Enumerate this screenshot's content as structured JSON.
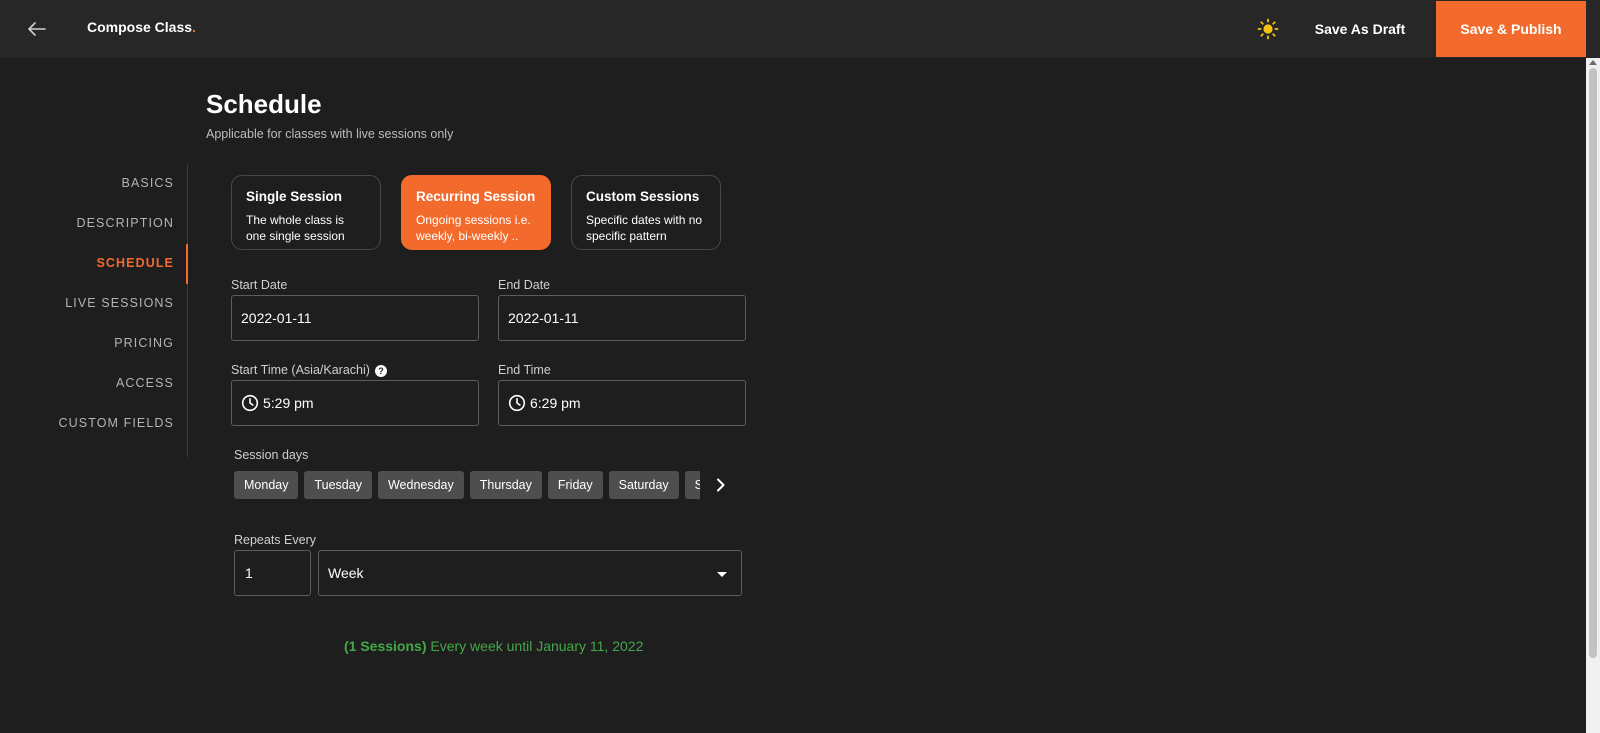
{
  "header": {
    "title": "Compose Class",
    "title_dot": ".",
    "save_draft_label": "Save As Draft",
    "save_publish_label": "Save & Publish",
    "back_icon": "arrow-left-icon",
    "theme_icon": "sun-icon",
    "accent_color": "#f26b2c"
  },
  "sidebar": {
    "items": [
      {
        "label": "BASICS"
      },
      {
        "label": "DESCRIPTION"
      },
      {
        "label": "SCHEDULE",
        "active": true
      },
      {
        "label": "LIVE SESSIONS"
      },
      {
        "label": "PRICING"
      },
      {
        "label": "ACCESS"
      },
      {
        "label": "CUSTOM FIELDS"
      }
    ]
  },
  "schedule": {
    "title": "Schedule",
    "subtitle": "Applicable for classes with live sessions only",
    "session_types": [
      {
        "title": "Single Session",
        "desc": "The whole class is one single session",
        "selected": false
      },
      {
        "title": "Recurring Session",
        "desc": "Ongoing sessions i.e. weekly, bi-weekly ..",
        "selected": true
      },
      {
        "title": "Custom Sessions",
        "desc": "Specific dates with no specific pattern",
        "selected": false
      }
    ],
    "start_date_label": "Start Date",
    "start_date_value": "2022-01-11",
    "end_date_label": "End Date",
    "end_date_value": "2022-01-11",
    "start_time_label": "Start Time (Asia/Karachi)",
    "start_time_help": "?",
    "start_time_value": "5:29 pm",
    "end_time_label": "End Time",
    "end_time_value": "6:29 pm",
    "session_days_label": "Session days",
    "days": [
      "Monday",
      "Tuesday",
      "Wednesday",
      "Thursday",
      "Friday",
      "Saturday",
      "Sunday"
    ],
    "repeats_label": "Repeats Every",
    "repeats_value": "1",
    "repeats_unit": "Week",
    "summary_count": "(1 Sessions)",
    "summary_text": "Every week until January 11, 2022",
    "summary_color": "#44a84a"
  }
}
